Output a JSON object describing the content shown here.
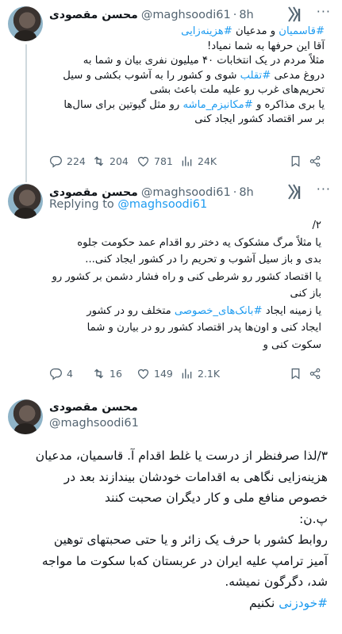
{
  "author": {
    "name": "محسن مقصودی",
    "handle": "@maghsoodi61"
  },
  "tweets": [
    {
      "time": "8h",
      "lines": [
        [
          "#قاسمیان",
          " و مدعیان ",
          "#هزینه‌زایی"
        ],
        [
          "آقا این حرفها به شما نمیاد!"
        ],
        [
          "مثلاً مردم در یک انتخابات ۴۰ میلیون نفری بیان و شما به"
        ],
        [
          "دروغ مدعی ",
          "#تقلب",
          " شوی و کشور را به آشوب بکشی و سیل"
        ],
        [
          "تحریم‌های غرب رو علیه ملت باعث بشی"
        ],
        [
          "یا بری مذاکره و ",
          "#مکانیزم_ماشه",
          " رو مثل گیوتین برای سال‌ها"
        ],
        [
          "بر سر اقتصاد کشور ایجاد کنی"
        ]
      ],
      "stats": {
        "replies": "224",
        "reposts": "204",
        "likes": "781",
        "views": "24K"
      }
    },
    {
      "time": "8h",
      "replying_label": "Replying to",
      "replying_handle": "@maghsoodi61",
      "lines": [
        [
          "۲/"
        ],
        [
          "یا مثلاً مرگ مشکوک یه دختر رو اقدام عمد حکومت جلوه"
        ],
        [
          "بدی و باز سیل آشوب و تحریم را در کشور ایجاد کنی..."
        ],
        [
          "یا اقتصاد کشور رو شرطی کنی و راه فشار دشمن بر کشور رو"
        ],
        [
          "باز کنی"
        ],
        [
          "یا زمینه ایجاد ",
          "#بانک‌های_خصوصی",
          " متخلف رو در کشور"
        ],
        [
          "ایجاد کنی و اون‌ها پدر اقتصاد کشور رو در بیارن و شما"
        ],
        [
          "سکوت کنی و"
        ]
      ],
      "stats": {
        "replies": "4",
        "reposts": "16",
        "likes": "149",
        "views": "2.1K"
      }
    },
    {
      "lines": [
        [
          "۳/لذا صرفنظر از درست یا غلط اقدام آ. قاسمیان، مدعیان"
        ],
        [
          "هزینه‌زایی نگاهی به اقدامات خودشان بیندازند بعد در"
        ],
        [
          "خصوص منافع ملی و کار دیگران صحبت کنند"
        ],
        [
          "پ.ن:"
        ],
        [
          "روابط کشور با حرف یک زائر و یا حتی صحبتهای توهین"
        ],
        [
          "آمیز ترامپ علیه ایران در عربستان که‌با سکوت ما مواجه"
        ],
        [
          "شد، دگرگون نمیشه."
        ],
        [
          "#خودزنی",
          " نکنیم"
        ]
      ]
    }
  ],
  "icons": {
    "more": "more-icon",
    "logo": "x-logo-icon",
    "reply": "reply-icon",
    "repost": "repost-icon",
    "like": "heart-icon",
    "views": "views-icon",
    "bookmark": "bookmark-icon",
    "share": "share-icon"
  },
  "colors": {
    "link": "#1d9bf0",
    "muted": "#536471",
    "text": "#0f1419",
    "thread": "#cfd9de"
  }
}
